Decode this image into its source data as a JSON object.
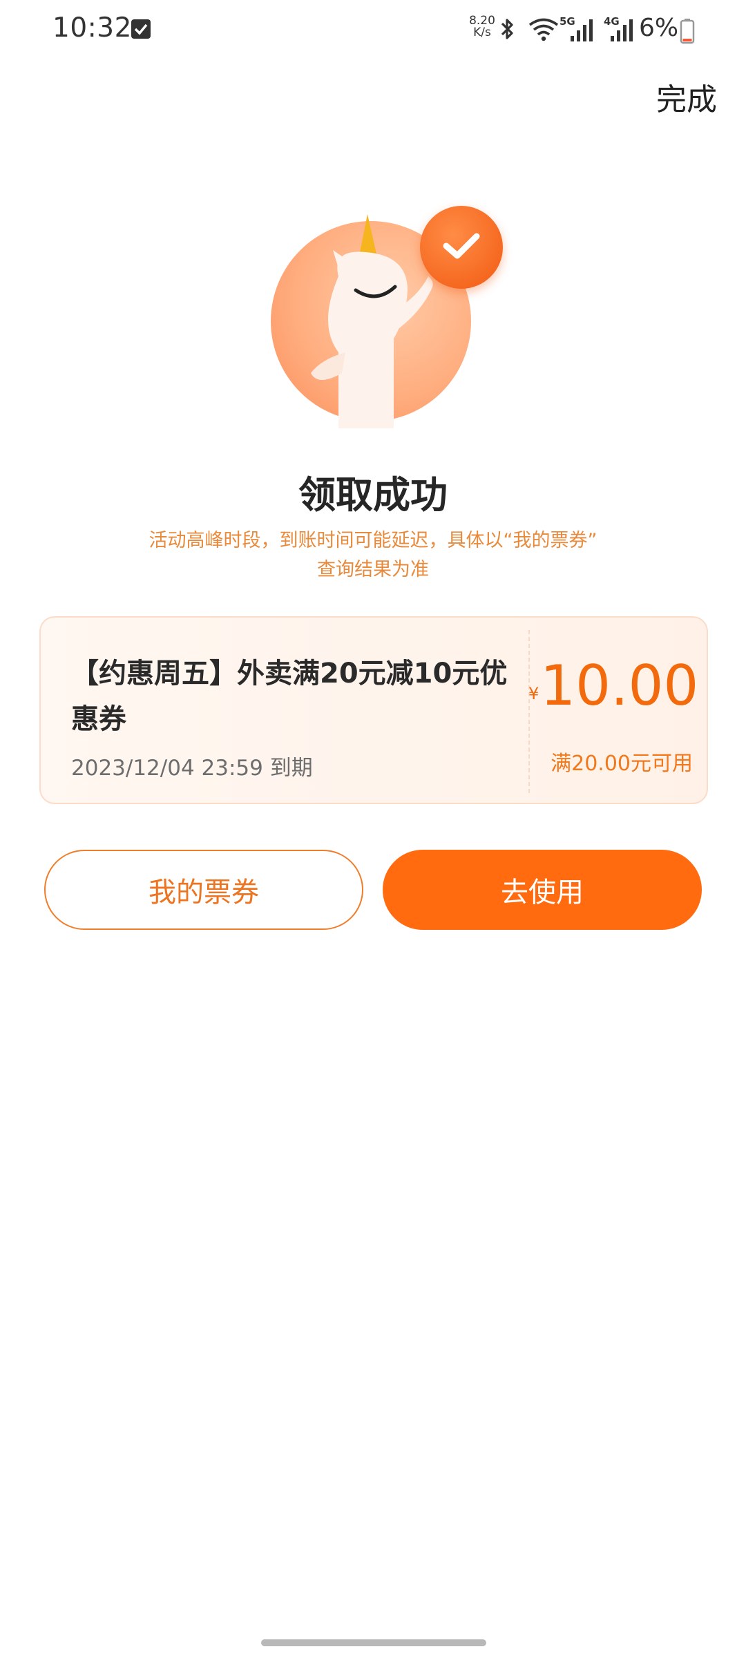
{
  "status_bar": {
    "time": "10:32",
    "net_speed_value": "8.20",
    "net_speed_unit": "K/s",
    "wifi_label": "5G",
    "cell_label": "4G",
    "battery": "6%",
    "icons": [
      "checkbox-icon",
      "bluetooth-icon",
      "wifi-icon",
      "signal-icon",
      "signal-icon",
      "battery-icon"
    ]
  },
  "header": {
    "done_label": "完成"
  },
  "result": {
    "title": "领取成功",
    "notice_line1": "活动高峰时段，到账时间可能延迟，具体以“我的票券”",
    "notice_line2": "查询结果为准"
  },
  "coupon": {
    "title": "【约惠周五】外卖满20元减10元优惠券",
    "expiry": "2023/12/04 23:59 到期",
    "currency_symbol": "¥",
    "amount": "10.00",
    "threshold": "满20.00元可用"
  },
  "actions": {
    "my_tickets_label": "我的票券",
    "use_label": "去使用"
  },
  "colors": {
    "accent": "#ff6b0e",
    "accent_text": "#f36a0c",
    "notice": "#e88a3c"
  }
}
